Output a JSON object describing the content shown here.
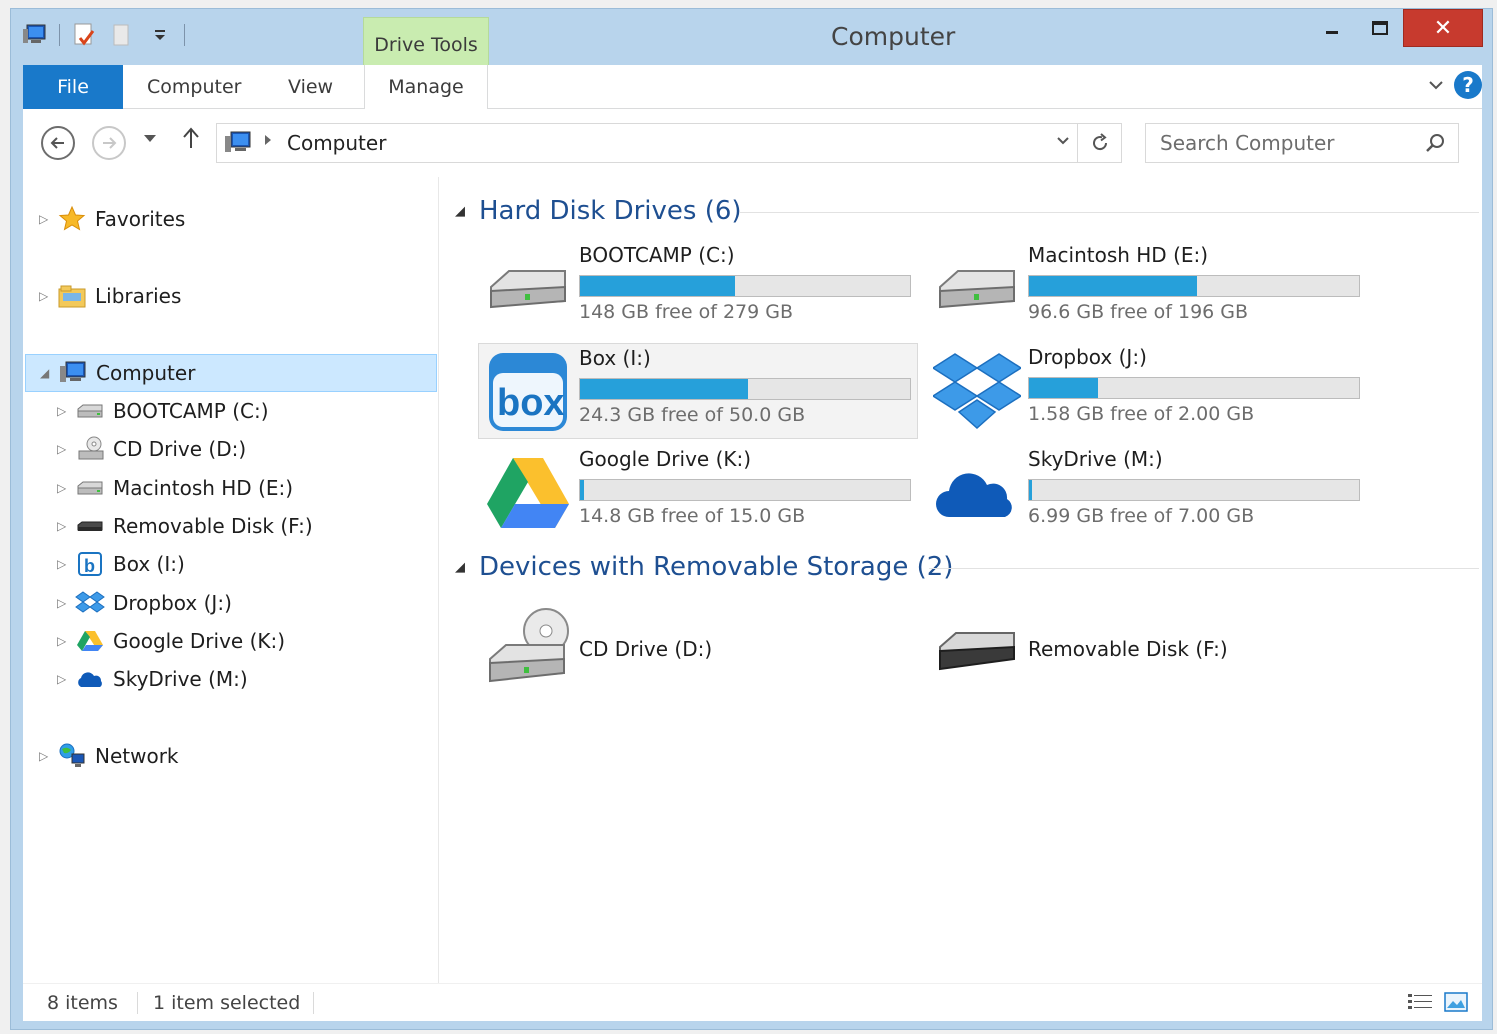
{
  "window": {
    "title": "Computer",
    "contextual_tab": "Drive Tools",
    "close_glyph": "✕",
    "minimize_glyph": "–",
    "maximize_glyph": "□"
  },
  "ribbon": {
    "tabs": [
      {
        "label": "File"
      },
      {
        "label": "Computer"
      },
      {
        "label": "View"
      },
      {
        "label": "Manage"
      }
    ],
    "help_glyph": "?"
  },
  "address": {
    "path": "Computer",
    "search_placeholder": "Search Computer"
  },
  "navpane": {
    "items": [
      {
        "label": "Favorites",
        "icon": "star-icon"
      },
      {
        "label": "Libraries",
        "icon": "libraries-icon"
      },
      {
        "label": "Computer",
        "icon": "computer-icon",
        "selected": true
      },
      {
        "label": "BOOTCAMP (C:)",
        "icon": "hard-drive-icon"
      },
      {
        "label": "CD Drive (D:)",
        "icon": "cd-drive-icon"
      },
      {
        "label": "Macintosh HD (E:)",
        "icon": "hard-drive-icon"
      },
      {
        "label": "Removable Disk (F:)",
        "icon": "removable-disk-icon"
      },
      {
        "label": "Box (I:)",
        "icon": "box-icon"
      },
      {
        "label": "Dropbox (J:)",
        "icon": "dropbox-icon"
      },
      {
        "label": "Google Drive (K:)",
        "icon": "google-drive-icon"
      },
      {
        "label": "SkyDrive (M:)",
        "icon": "skydrive-icon"
      },
      {
        "label": "Network",
        "icon": "network-icon"
      }
    ]
  },
  "groups": {
    "hard_disks": {
      "title": "Hard Disk Drives (6)",
      "drives": [
        {
          "name": "BOOTCAMP (C:)",
          "free": "148 GB free of 279 GB",
          "used_fraction": 0.47,
          "icon": "hard-drive-icon"
        },
        {
          "name": "Macintosh HD (E:)",
          "free": "96.6 GB free of 196 GB",
          "used_fraction": 0.51,
          "icon": "hard-drive-icon"
        },
        {
          "name": "Box (I:)",
          "free": "24.3 GB free of 50.0 GB",
          "used_fraction": 0.51,
          "icon": "box-icon"
        },
        {
          "name": "Dropbox (J:)",
          "free": "1.58 GB free of 2.00 GB",
          "used_fraction": 0.21,
          "icon": "dropbox-icon"
        },
        {
          "name": "Google Drive (K:)",
          "free": "14.8 GB free of 15.0 GB",
          "used_fraction": 0.013,
          "icon": "google-drive-icon"
        },
        {
          "name": "SkyDrive (M:)",
          "free": "6.99 GB free of 7.00 GB",
          "used_fraction": 0.001,
          "icon": "skydrive-icon"
        }
      ]
    },
    "removable": {
      "title": "Devices with Removable Storage (2)",
      "devices": [
        {
          "name": "CD Drive (D:)",
          "icon": "cd-drive-icon"
        },
        {
          "name": "Removable Disk (F:)",
          "icon": "removable-disk-icon"
        }
      ]
    }
  },
  "status": {
    "items": "8 items",
    "selected": "1 item selected"
  },
  "colors": {
    "accent": "#1979ca",
    "progress": "#26a0da",
    "group_header": "#1e4f91",
    "close_button": "#c73a2e"
  }
}
